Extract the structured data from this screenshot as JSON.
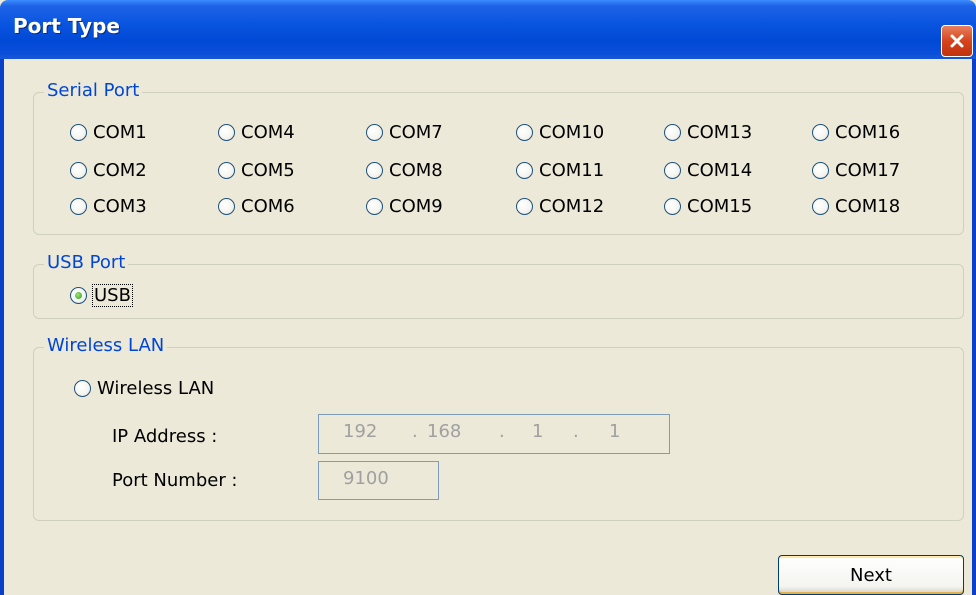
{
  "window": {
    "title": "Port Type",
    "close_icon": "close-icon"
  },
  "serial": {
    "legend": "Serial Port",
    "ports": [
      "COM1",
      "COM4",
      "COM7",
      "COM10",
      "COM13",
      "COM16",
      "COM2",
      "COM5",
      "COM8",
      "COM11",
      "COM14",
      "COM17",
      "COM3",
      "COM6",
      "COM9",
      "COM12",
      "COM15",
      "COM18"
    ]
  },
  "usb": {
    "legend": "USB Port",
    "option": "USB",
    "selected": true
  },
  "wireless": {
    "legend": "Wireless LAN",
    "option": "Wireless LAN",
    "ip_label": "IP Address :",
    "ip": [
      "192",
      "168",
      "1",
      "1"
    ],
    "port_label": "Port Number :",
    "port_value": "9100"
  },
  "buttons": {
    "next": "Next"
  },
  "colors": {
    "title_bar": "#0A55E0",
    "background": "#ECE9D8",
    "legend_text": "#0046D5",
    "disabled_text": "#A0A0A0"
  }
}
